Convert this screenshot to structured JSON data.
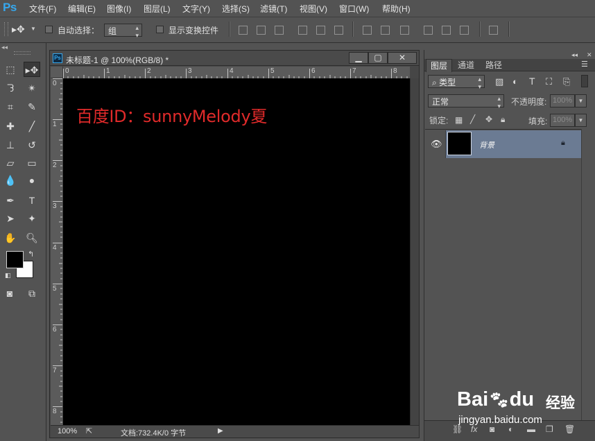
{
  "app": {
    "logo": "Ps"
  },
  "menubar": {
    "items": [
      "文件(F)",
      "编辑(E)",
      "图像(I)",
      "图层(L)",
      "文字(Y)",
      "选择(S)",
      "滤镜(T)",
      "视图(V)",
      "窗口(W)",
      "帮助(H)"
    ]
  },
  "options": {
    "auto_select_label": "自动选择：",
    "auto_select_value": "组",
    "show_transform_label": "显示变换控件"
  },
  "document": {
    "tab_icon": "Ps",
    "title": "未标题-1 @ 100%(RGB/8) *",
    "ruler_top": [
      "0",
      "1",
      "2",
      "3",
      "4",
      "5",
      "6",
      "7",
      "8"
    ],
    "ruler_left": [
      "0",
      "1",
      "2",
      "3",
      "4",
      "5",
      "6",
      "7",
      "8"
    ],
    "canvas_text": "百度ID：sunnyMelody夏",
    "canvas_text_color": "#e02a2a",
    "canvas_color": "#000000",
    "status_zoom": "100%",
    "status_doc": "文档:732.4K/0 字节"
  },
  "panel": {
    "tabs": [
      "图层",
      "通道",
      "路径"
    ],
    "filter_label": "类型",
    "blend_mode": "正常",
    "opacity_label": "不透明度:",
    "opacity_value": "100%",
    "lock_label": "锁定:",
    "fill_label": "填充:",
    "fill_value": "100%",
    "layer_name": "背景",
    "selected_row_color": "#6b7b93"
  },
  "watermark": {
    "brand": "Bai",
    "brand2": "du",
    "product": "经验",
    "url": "jingyan.baidu.com"
  },
  "colors": {
    "ui_bg": "#535353",
    "accent": "#36a8ee"
  }
}
